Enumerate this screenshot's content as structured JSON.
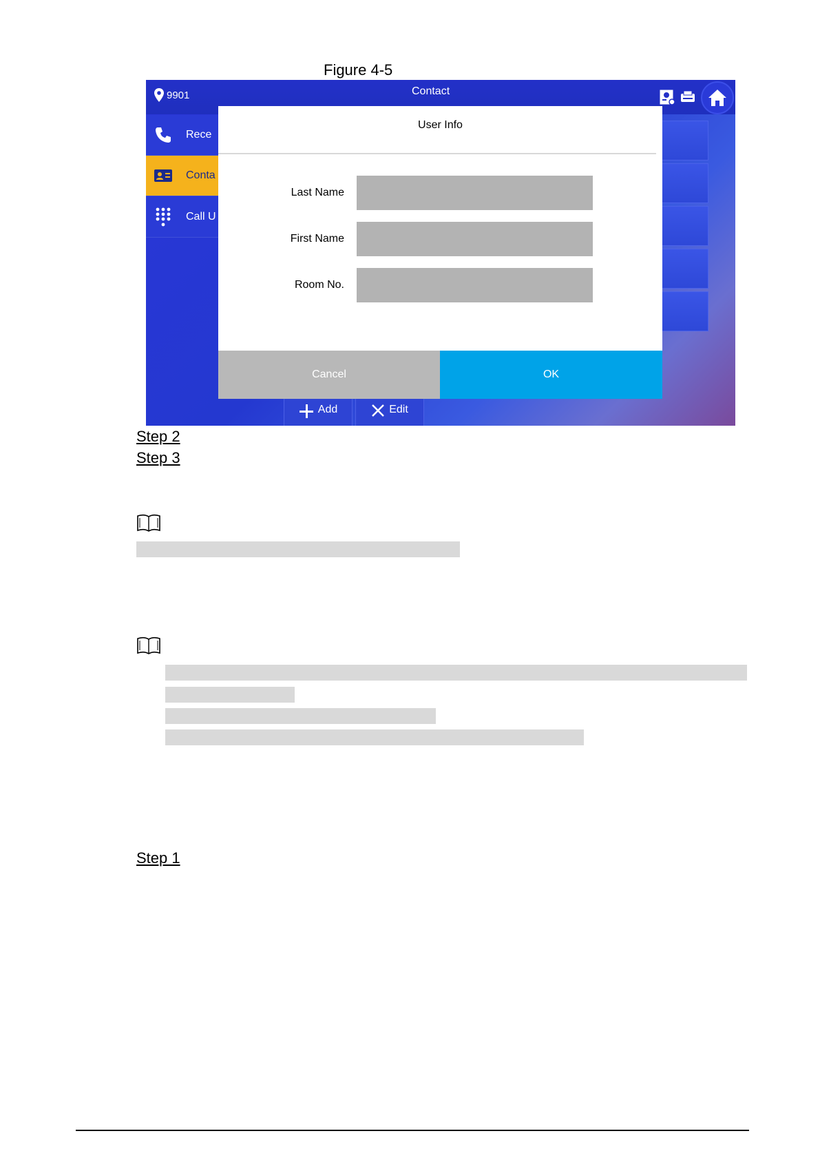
{
  "figure": {
    "caption": "Figure 4-5"
  },
  "device": {
    "id": "9901",
    "title": "Contact",
    "top_icons": [
      "monitor-icon",
      "printer-icon",
      "home-icon"
    ],
    "sidebar": [
      {
        "label": "Rece",
        "icon": "phone-icon",
        "active": false
      },
      {
        "label": "Conta",
        "icon": "contact-card-icon",
        "active": true
      },
      {
        "label": "Call U",
        "icon": "keypad-icon",
        "active": false
      }
    ],
    "bottom_buttons": {
      "add": "Add",
      "edit": "Edit"
    },
    "colors": {
      "active_tab": "#f5b21c",
      "ok": "#00a3e8",
      "cancel": "#b8b8b8",
      "screen": "#2a36d8"
    }
  },
  "modal": {
    "title": "User Info",
    "fields": [
      {
        "label": "Last Name",
        "value": ""
      },
      {
        "label": "First Name",
        "value": ""
      },
      {
        "label": "Room No.",
        "value": ""
      }
    ],
    "cancel_label": "Cancel",
    "ok_label": "OK"
  },
  "document": {
    "steps": [
      "Step 2",
      "Step 3",
      "Step 1"
    ],
    "note_icon": "book-icon"
  }
}
